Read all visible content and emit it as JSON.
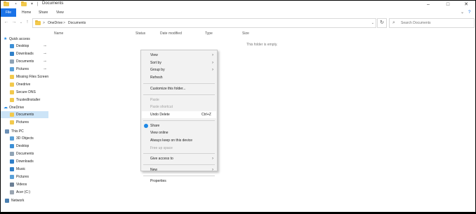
{
  "window": {
    "title": "Documents",
    "controls": {
      "minimize": "–",
      "maximize": "□",
      "close": "✕"
    }
  },
  "ribbon": {
    "tabs": [
      "File",
      "Home",
      "Share",
      "View"
    ],
    "expand_icon": "chevron-down-icon",
    "help_icon": "help-icon"
  },
  "address": {
    "back": "←",
    "forward": "→",
    "up_dropdown": "⌄",
    "up": "↑",
    "crumbs": [
      "OneDrive",
      "Documents"
    ],
    "separator": ">",
    "dropdown": "⌄",
    "refresh": "↻",
    "search_placeholder": "Search Documents"
  },
  "columns": [
    "Name",
    "Status",
    "Date modified",
    "Type",
    "Size"
  ],
  "empty_message": "This folder is empty.",
  "sidebar": {
    "quick_access_label": "Quick access",
    "quick_access": [
      {
        "label": "Desktop",
        "pinned": true,
        "icon_color": "#3b8fd6"
      },
      {
        "label": "Downloads",
        "pinned": true,
        "icon_color": "#2f7fc8"
      },
      {
        "label": "Documents",
        "pinned": true,
        "icon_color": "#8fa3b5"
      },
      {
        "label": "Pictures",
        "pinned": true,
        "icon_color": "#5aa0d8"
      },
      {
        "label": "Missing Files Screen",
        "pinned": false,
        "icon_color": "#f2c94c"
      },
      {
        "label": "Onedrive",
        "pinned": false,
        "icon_color": "#f2c94c"
      },
      {
        "label": "Secure DNS",
        "pinned": false,
        "icon_color": "#f2c94c"
      },
      {
        "label": "TrustedInstaller",
        "pinned": false,
        "icon_color": "#f2c94c"
      }
    ],
    "onedrive_label": "OneDrive",
    "onedrive": [
      {
        "label": "Documents",
        "selected": true,
        "icon_color": "#f2c94c"
      },
      {
        "label": "Pictures",
        "selected": false,
        "icon_color": "#f2c94c"
      }
    ],
    "thispc_label": "This PC",
    "thispc": [
      {
        "label": "3D Objects",
        "icon_color": "#5aa0d8"
      },
      {
        "label": "Desktop",
        "icon_color": "#3b8fd6"
      },
      {
        "label": "Documents",
        "icon_color": "#8fa3b5"
      },
      {
        "label": "Downloads",
        "icon_color": "#2f7fc8"
      },
      {
        "label": "Music",
        "icon_color": "#2f7fc8"
      },
      {
        "label": "Pictures",
        "icon_color": "#5aa0d8"
      },
      {
        "label": "Videos",
        "icon_color": "#6b7f95"
      },
      {
        "label": "Acer (C:)",
        "icon_color": "#9aa5b1"
      }
    ],
    "network_label": "Network",
    "pin_glyph": "📌"
  },
  "context_menu": {
    "items": [
      {
        "label": "View",
        "submenu": true,
        "disabled": false
      },
      {
        "label": "Sort by",
        "submenu": true,
        "disabled": false
      },
      {
        "label": "Group by",
        "submenu": true,
        "disabled": false
      },
      {
        "label": "Refresh",
        "submenu": false,
        "disabled": false
      },
      {
        "sep": true
      },
      {
        "label": "Customize this folder...",
        "submenu": false,
        "disabled": false
      },
      {
        "sep": true
      },
      {
        "label": "Paste",
        "submenu": false,
        "disabled": true
      },
      {
        "label": "Paste shortcut",
        "submenu": false,
        "disabled": true
      },
      {
        "label": "Undo Delete",
        "shortcut": "Ctrl+Z",
        "submenu": false,
        "disabled": false,
        "hover": true
      },
      {
        "sep": true
      },
      {
        "label": "Share",
        "submenu": false,
        "disabled": false,
        "icon": "share-icon"
      },
      {
        "label": "View online",
        "submenu": false,
        "disabled": false
      },
      {
        "label": "Always keep on this device",
        "submenu": false,
        "disabled": false
      },
      {
        "label": "Free up space",
        "submenu": false,
        "disabled": true
      },
      {
        "sep": true
      },
      {
        "label": "Give access to",
        "submenu": true,
        "disabled": false
      },
      {
        "sep": true
      },
      {
        "label": "New",
        "submenu": true,
        "disabled": false
      },
      {
        "sep": true
      },
      {
        "label": "Properties",
        "submenu": false,
        "disabled": false
      }
    ]
  }
}
